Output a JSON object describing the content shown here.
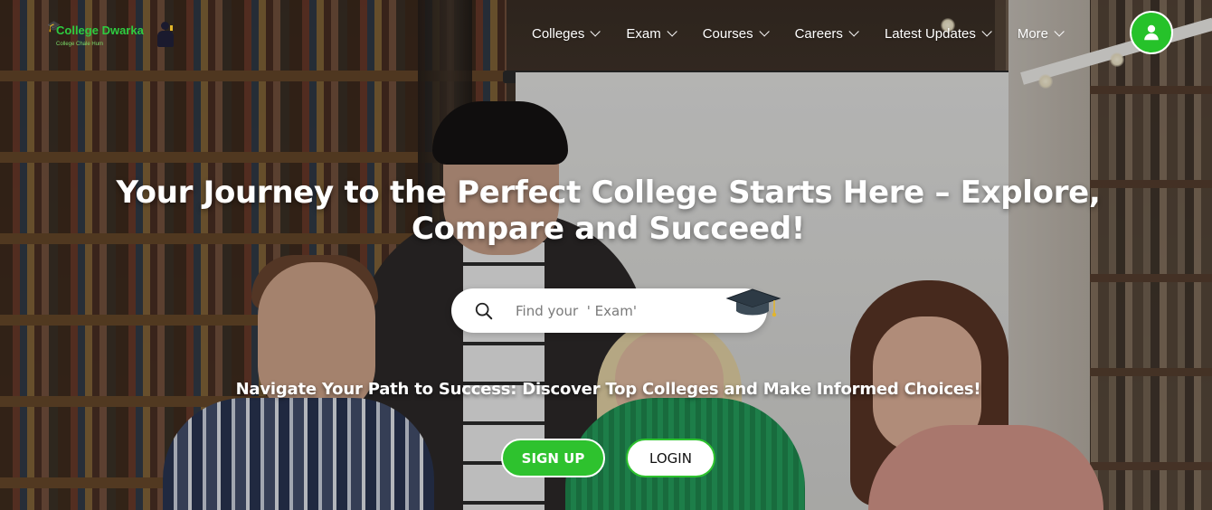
{
  "brand": {
    "name": "College Dwarka",
    "tagline": "College Chale Hum"
  },
  "nav": {
    "items": [
      {
        "label": "Colleges"
      },
      {
        "label": "Exam"
      },
      {
        "label": "Courses"
      },
      {
        "label": "Careers"
      },
      {
        "label": "Latest Updates"
      },
      {
        "label": "More"
      }
    ]
  },
  "hero": {
    "headline": "Your Journey to the Perfect College Starts Here – Explore, Compare and Succeed!",
    "search_placeholder": "Find your  ' Exam'",
    "subline": "Navigate Your Path to Success: Discover Top Colleges and Make Informed Choices!",
    "signup_label": "SIGN UP",
    "login_label": "LOGIN"
  },
  "icons": {
    "user": "user-icon",
    "search": "search-icon",
    "grad_cap": "graduation-cap-icon",
    "chevron": "chevron-down-icon"
  },
  "colors": {
    "accent": "#2ec22e",
    "text_on_image": "#ffffff"
  }
}
